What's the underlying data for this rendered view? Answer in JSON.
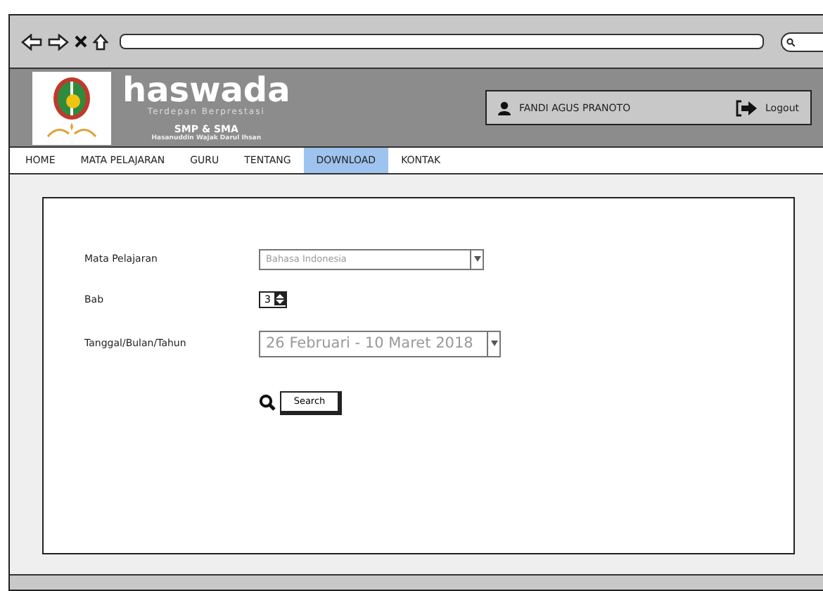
{
  "header": {
    "brand": "haswada",
    "tagline": "Terdepan Berprestasi",
    "level": "SMP & SMA",
    "school": "Hasanuddin Wajak Darul Ihsan"
  },
  "user": {
    "name": "FANDI AGUS PRANOTO",
    "logout": "Logout"
  },
  "nav": [
    {
      "label": "HOME",
      "selected": false
    },
    {
      "label": "MATA PELAJARAN",
      "selected": false
    },
    {
      "label": "GURU",
      "selected": false
    },
    {
      "label": "TENTANG",
      "selected": false
    },
    {
      "label": "DOWNLOAD",
      "selected": true
    },
    {
      "label": "KONTAK",
      "selected": false
    }
  ],
  "form": {
    "fields": [
      {
        "label": "Mata Pelajaran",
        "kind": "select",
        "value": "Bahasa Indonesia"
      },
      {
        "label": "Bab",
        "kind": "spinner",
        "value": "3"
      },
      {
        "label": "Tanggal/Bulan/Tahun",
        "kind": "range-select",
        "value": "26 Februari - 10 Maret 2018"
      }
    ],
    "search_button": "Search"
  }
}
